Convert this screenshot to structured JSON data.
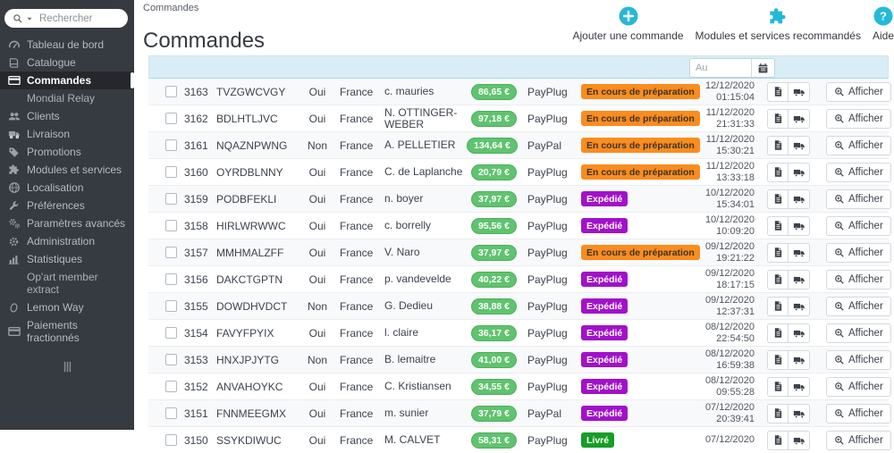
{
  "colors": {
    "accent": "#25b9d7",
    "sidebar_bg": "#363a41",
    "filter_row_bg": "#d9edf7",
    "price_pill": {
      "bg": "#5fc36f",
      "border": "#4daf5f",
      "fg": "#ffffff"
    },
    "status_styles": {
      "prep": {
        "bg": "#fb8c1e",
        "fg": "#3a342c"
      },
      "shipped": {
        "bg": "#a111c9",
        "fg": "#ffffff"
      },
      "delivered": {
        "bg": "#169e26",
        "fg": "#ffffff"
      }
    }
  },
  "sidebar": {
    "search_placeholder": "Rechercher",
    "items": [
      {
        "id": "dashboard",
        "icon": "gauge-icon",
        "label": "Tableau de bord"
      },
      {
        "id": "catalogue",
        "icon": "book-icon",
        "label": "Catalogue"
      },
      {
        "id": "commandes",
        "icon": "credit-card-icon",
        "label": "Commandes",
        "active": true
      },
      {
        "id": "mondial-relay",
        "sub": true,
        "label": "Mondial Relay"
      },
      {
        "id": "clients",
        "icon": "users-icon",
        "label": "Clients"
      },
      {
        "id": "livraison",
        "icon": "truck-icon",
        "label": "Livraison"
      },
      {
        "id": "promotions",
        "icon": "tag-icon",
        "label": "Promotions"
      },
      {
        "id": "modules",
        "icon": "puzzle-icon",
        "label": "Modules et services"
      },
      {
        "id": "localisation",
        "icon": "globe-icon",
        "label": "Localisation"
      },
      {
        "id": "preferences",
        "icon": "wrench-icon",
        "label": "Préférences"
      },
      {
        "id": "parametres",
        "icon": "gears-icon",
        "label": "Paramètres avancés"
      },
      {
        "id": "administration",
        "icon": "gear-icon",
        "label": "Administration"
      },
      {
        "id": "statistiques",
        "icon": "bar-chart-icon",
        "label": "Statistiques"
      },
      {
        "id": "opart-extract",
        "sub": true,
        "label": "Op'art member extract"
      },
      {
        "id": "lemon-way",
        "icon": "oval-icon",
        "label": "Lemon Way"
      },
      {
        "id": "paiements",
        "icon": "credit-card-icon",
        "label": "Paiements fractionnés"
      }
    ]
  },
  "header": {
    "breadcrumb": "Commandes",
    "title": "Commandes",
    "actions": [
      {
        "id": "add-order",
        "icon": "plus-circle-icon",
        "label": "Ajouter une commande"
      },
      {
        "id": "recommended-modules",
        "icon": "puzzle-large-icon",
        "label": "Modules et services recommandés"
      },
      {
        "id": "help",
        "icon": "question-circle-icon",
        "label": "Aide"
      }
    ]
  },
  "filter": {
    "au_placeholder": "Au"
  },
  "table": {
    "view_label": "Afficher",
    "orders": [
      {
        "id": "3163",
        "reference": "TVZGWCVGY",
        "new_customer": "Oui",
        "delivery": "France",
        "customer": "c. mauries",
        "total": "86,65 €",
        "payment": "PayPlug",
        "status": {
          "label": "En cours de préparation",
          "type": "prep"
        },
        "date": "12/12/2020",
        "time": "01:15:04"
      },
      {
        "id": "3162",
        "reference": "BDLHTLJVC",
        "new_customer": "Oui",
        "delivery": "France",
        "customer": "N. OTTINGER-WEBER",
        "total": "97,18 €",
        "payment": "PayPlug",
        "status": {
          "label": "En cours de préparation",
          "type": "prep"
        },
        "date": "11/12/2020",
        "time": "21:31:33"
      },
      {
        "id": "3161",
        "reference": "NQAZNPWNG",
        "new_customer": "Non",
        "delivery": "France",
        "customer": "A. PELLETIER",
        "total": "134,64 €",
        "payment": "PayPal",
        "status": {
          "label": "En cours de préparation",
          "type": "prep"
        },
        "date": "11/12/2020",
        "time": "15:30:21"
      },
      {
        "id": "3160",
        "reference": "OYRDBLNNY",
        "new_customer": "Oui",
        "delivery": "France",
        "customer": "C. de Laplanche",
        "total": "20,79 €",
        "payment": "PayPlug",
        "status": {
          "label": "En cours de préparation",
          "type": "prep"
        },
        "date": "11/12/2020",
        "time": "13:33:18"
      },
      {
        "id": "3159",
        "reference": "PODBFEKLI",
        "new_customer": "Oui",
        "delivery": "France",
        "customer": "n. boyer",
        "total": "37,97 €",
        "payment": "PayPlug",
        "status": {
          "label": "Expédié",
          "type": "shipped"
        },
        "date": "10/12/2020",
        "time": "15:34:01"
      },
      {
        "id": "3158",
        "reference": "HIRLWRWWC",
        "new_customer": "Oui",
        "delivery": "France",
        "customer": "c. borrelly",
        "total": "95,56 €",
        "payment": "PayPlug",
        "status": {
          "label": "Expédié",
          "type": "shipped"
        },
        "date": "10/12/2020",
        "time": "10:09:20"
      },
      {
        "id": "3157",
        "reference": "MMHMALZFF",
        "new_customer": "Oui",
        "delivery": "France",
        "customer": "V. Naro",
        "total": "37,97 €",
        "payment": "PayPlug",
        "status": {
          "label": "En cours de préparation",
          "type": "prep"
        },
        "date": "09/12/2020",
        "time": "19:21:22"
      },
      {
        "id": "3156",
        "reference": "DAKCTGPTN",
        "new_customer": "Oui",
        "delivery": "France",
        "customer": "p. vandevelde",
        "total": "40,22 €",
        "payment": "PayPlug",
        "status": {
          "label": "Expédié",
          "type": "shipped"
        },
        "date": "09/12/2020",
        "time": "18:17:15"
      },
      {
        "id": "3155",
        "reference": "DOWDHVDCT",
        "new_customer": "Non",
        "delivery": "France",
        "customer": "G. Dedieu",
        "total": "38,88 €",
        "payment": "PayPlug",
        "status": {
          "label": "Expédié",
          "type": "shipped"
        },
        "date": "09/12/2020",
        "time": "12:37:31"
      },
      {
        "id": "3154",
        "reference": "FAVYFPYIX",
        "new_customer": "Oui",
        "delivery": "France",
        "customer": "l. claire",
        "total": "36,17 €",
        "payment": "PayPlug",
        "status": {
          "label": "Expédié",
          "type": "shipped"
        },
        "date": "08/12/2020",
        "time": "22:54:50"
      },
      {
        "id": "3153",
        "reference": "HNXJPJYTG",
        "new_customer": "Non",
        "delivery": "France",
        "customer": "B. lemaitre",
        "total": "41,00 €",
        "payment": "PayPlug",
        "status": {
          "label": "Expédié",
          "type": "shipped"
        },
        "date": "08/12/2020",
        "time": "16:59:38"
      },
      {
        "id": "3152",
        "reference": "ANVAHOYKC",
        "new_customer": "Oui",
        "delivery": "France",
        "customer": "C. Kristiansen",
        "total": "34,55 €",
        "payment": "PayPlug",
        "status": {
          "label": "Expédié",
          "type": "shipped"
        },
        "date": "08/12/2020",
        "time": "09:55:28"
      },
      {
        "id": "3151",
        "reference": "FNNMEEGMX",
        "new_customer": "Oui",
        "delivery": "France",
        "customer": "m. sunier",
        "total": "37,79 €",
        "payment": "PayPal",
        "status": {
          "label": "Expédié",
          "type": "shipped"
        },
        "date": "07/12/2020",
        "time": "20:39:41"
      },
      {
        "id": "3150",
        "reference": "SSYKDIWUC",
        "new_customer": "Oui",
        "delivery": "France",
        "customer": "M. CALVET",
        "total": "58,31 €",
        "payment": "PayPlug",
        "status": {
          "label": "Livré",
          "type": "delivered"
        },
        "date": "07/12/2020",
        "time": ""
      }
    ]
  }
}
